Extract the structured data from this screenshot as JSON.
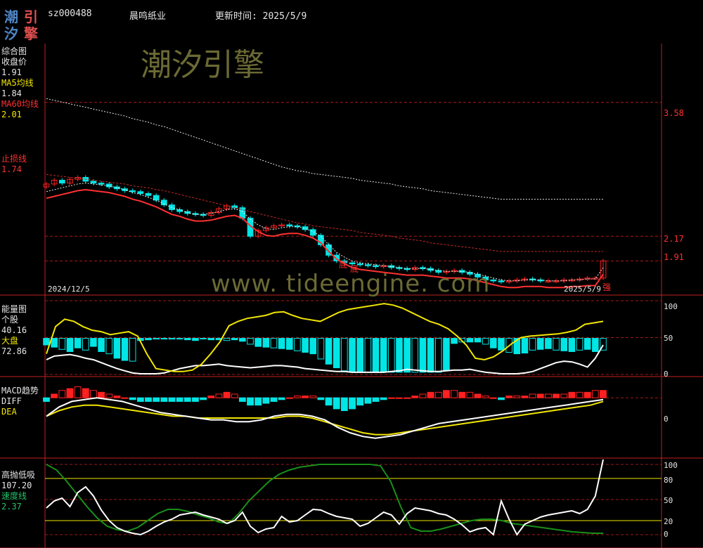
{
  "header": {
    "logo_chars": [
      "潮",
      "引",
      "汐",
      "擎"
    ],
    "stock_code": "sz000488",
    "stock_name": "晨鸣纸业",
    "update_label": "更新时间: 2025/5/9"
  },
  "watermarks": {
    "brand": "潮汐引擎",
    "url": "www. tideengine. com"
  },
  "colors": {
    "up": "#ff2020",
    "down": "#00e5e5",
    "ma5": "#ffffff",
    "ma60": "#ff3030",
    "dea": "#f2e600",
    "speed": "#1a8f1a"
  },
  "panels": {
    "main": {
      "title": "综合图",
      "close_label": "收盘价",
      "close_value": "1.91",
      "ma5_label": "MA5均线",
      "ma5_value": "1.84",
      "ma60_label": "MA60均线",
      "ma60_value": "2.01",
      "stop_label": "止损线",
      "stop_value": "1.74",
      "date_start": "2024/12/5",
      "date_end": "2025/5/9",
      "price_levels": [
        "3.58",
        "2.17",
        "1.91"
      ],
      "markers": [
        "底",
        "底"
      ],
      "strong_label": "强"
    },
    "energy": {
      "title": "能量图",
      "stock_label": "个股",
      "stock_value": "40.16",
      "market_label": "大盘",
      "market_value": "72.86",
      "axis": [
        "100",
        "50",
        "0"
      ]
    },
    "macd": {
      "title": "MACD趋势",
      "diff_label": "DIFF",
      "dea_label": "DEA",
      "axis": [
        "0"
      ]
    },
    "tide": {
      "title": "高抛低吸",
      "value": "107.20",
      "speed_label": "速度线",
      "speed_value": "2.37",
      "axis": [
        "100",
        "80",
        "50",
        "20",
        "0"
      ]
    }
  },
  "chart_data": [
    {
      "type": "candlestick",
      "title": "综合图",
      "x_start": "2024/12/5",
      "x_end": "2025/5/9",
      "ylim": [
        1.55,
        4.2
      ],
      "close": [
        2.72,
        2.76,
        2.73,
        2.77,
        2.79,
        2.75,
        2.73,
        2.72,
        2.69,
        2.67,
        2.65,
        2.64,
        2.62,
        2.6,
        2.55,
        2.5,
        2.45,
        2.43,
        2.41,
        2.4,
        2.39,
        2.42,
        2.46,
        2.49,
        2.47,
        2.36,
        2.17,
        2.23,
        2.26,
        2.28,
        2.29,
        2.28,
        2.27,
        2.24,
        2.18,
        2.08,
        1.97,
        1.91,
        1.89,
        1.88,
        1.87,
        1.86,
        1.85,
        1.86,
        1.84,
        1.83,
        1.82,
        1.84,
        1.83,
        1.81,
        1.79,
        1.8,
        1.81,
        1.79,
        1.77,
        1.74,
        1.71,
        1.7,
        1.69,
        1.7,
        1.71,
        1.72,
        1.71,
        1.7,
        1.7,
        1.7,
        1.71,
        1.71,
        1.72,
        1.73,
        1.73,
        1.91
      ],
      "ma5": [
        2.64,
        2.66,
        2.68,
        2.7,
        2.72,
        2.73,
        2.72,
        2.71,
        2.7,
        2.68,
        2.66,
        2.63,
        2.61,
        2.58,
        2.55,
        2.51,
        2.47,
        2.45,
        2.42,
        2.4,
        2.4,
        2.41,
        2.43,
        2.45,
        2.46,
        2.43,
        2.35,
        2.29,
        2.25,
        2.24,
        2.26,
        2.27,
        2.27,
        2.25,
        2.22,
        2.17,
        2.08,
        2.0,
        1.95,
        1.91,
        1.89,
        1.88,
        1.87,
        1.86,
        1.85,
        1.84,
        1.83,
        1.83,
        1.83,
        1.82,
        1.81,
        1.8,
        1.8,
        1.8,
        1.79,
        1.77,
        1.75,
        1.73,
        1.71,
        1.7,
        1.7,
        1.71,
        1.71,
        1.71,
        1.7,
        1.7,
        1.7,
        1.71,
        1.71,
        1.72,
        1.72,
        1.84
      ],
      "ma60": [
        2.82,
        2.81,
        2.8,
        2.79,
        2.78,
        2.77,
        2.76,
        2.75,
        2.74,
        2.73,
        2.72,
        2.7,
        2.69,
        2.68,
        2.66,
        2.65,
        2.63,
        2.61,
        2.59,
        2.57,
        2.55,
        2.53,
        2.51,
        2.49,
        2.47,
        2.45,
        2.43,
        2.41,
        2.39,
        2.37,
        2.35,
        2.33,
        2.31,
        2.3,
        2.28,
        2.27,
        2.26,
        2.25,
        2.24,
        2.23,
        2.21,
        2.2,
        2.19,
        2.18,
        2.17,
        2.15,
        2.14,
        2.13,
        2.12,
        2.1,
        2.09,
        2.08,
        2.07,
        2.06,
        2.05,
        2.04,
        2.03,
        2.02,
        2.01,
        2.01,
        2.01,
        2.01,
        2.01,
        2.01,
        2.01,
        2.01,
        2.01,
        2.01,
        2.01,
        2.01,
        2.01,
        2.01
      ],
      "price_levels": [
        3.58,
        2.17,
        1.91
      ]
    },
    {
      "type": "bar+line",
      "title": "能量图",
      "ylim": [
        0,
        100
      ],
      "series": [
        {
          "name": "个股",
          "values": [
            20,
            25,
            26,
            27,
            25,
            22,
            20,
            16,
            12,
            8,
            5,
            2,
            1,
            1,
            1,
            2,
            5,
            8,
            10,
            12,
            12,
            13,
            14,
            12,
            11,
            10,
            9,
            10,
            11,
            12,
            12,
            11,
            10,
            8,
            7,
            6,
            5,
            4,
            4,
            3,
            3,
            3,
            3,
            3,
            4,
            5,
            7,
            6,
            5,
            4,
            4,
            5,
            6,
            6,
            7,
            5,
            3,
            2,
            1,
            1,
            1,
            2,
            4,
            8,
            12,
            16,
            18,
            17,
            14,
            10,
            22,
            40
          ]
        },
        {
          "name": "大盘",
          "values": [
            28,
            65,
            75,
            72,
            65,
            60,
            58,
            54,
            56,
            58,
            52,
            28,
            8,
            6,
            4,
            4,
            6,
            14,
            28,
            44,
            66,
            72,
            76,
            78,
            80,
            84,
            85,
            80,
            76,
            74,
            72,
            78,
            84,
            88,
            90,
            92,
            94,
            96,
            94,
            90,
            84,
            78,
            72,
            68,
            62,
            52,
            40,
            22,
            20,
            24,
            32,
            42,
            50,
            52,
            53,
            54,
            55,
            57,
            60,
            68,
            70,
            72
          ]
        }
      ],
      "bars": [
        49,
        49,
        49,
        49,
        49,
        49,
        49,
        49,
        49,
        49,
        49,
        49,
        49,
        49,
        49,
        49,
        49,
        49,
        49,
        49,
        49,
        49,
        49,
        49,
        49,
        49,
        49,
        49,
        49,
        49,
        49,
        49,
        49,
        49,
        49,
        49,
        49,
        49,
        49,
        49,
        49,
        49,
        49,
        49,
        49,
        49,
        49,
        49,
        49,
        49,
        49,
        49,
        49,
        49,
        49,
        49,
        49,
        49,
        49,
        49,
        49,
        49,
        49,
        49,
        49,
        49,
        49,
        49,
        49,
        49,
        49,
        49
      ],
      "bar_bottoms": [
        40,
        37,
        34,
        31,
        36,
        33,
        38,
        31,
        28,
        22,
        19,
        18,
        46,
        47,
        48,
        48,
        48,
        48,
        47,
        46,
        48,
        47,
        47,
        46,
        47,
        45,
        41,
        38,
        37,
        36,
        35,
        34,
        32,
        30,
        28,
        21,
        14,
        9,
        5,
        3,
        4,
        3,
        3,
        3,
        3,
        3,
        3,
        3,
        3,
        3,
        3,
        6,
        42,
        44,
        44,
        44,
        41,
        36,
        33,
        30,
        28,
        29,
        33,
        34,
        35,
        33,
        32,
        31,
        33,
        34,
        31,
        33
      ],
      "axis_ticks": [
        100,
        50,
        0
      ]
    },
    {
      "type": "bar+line",
      "title": "MACD趋势",
      "ylim": [
        -0.32,
        0.1
      ],
      "macd_bars": [
        -0.02,
        0.02,
        0.04,
        0.05,
        0.06,
        0.05,
        0.04,
        0.03,
        0.02,
        0.01,
        0.0,
        -0.01,
        -0.02,
        -0.02,
        -0.02,
        -0.02,
        -0.02,
        -0.02,
        -0.02,
        -0.02,
        -0.01,
        0.01,
        0.02,
        0.03,
        0.02,
        -0.02,
        -0.04,
        -0.04,
        -0.03,
        -0.02,
        -0.01,
        0.0,
        0.01,
        0.01,
        0.01,
        -0.01,
        -0.04,
        -0.06,
        -0.07,
        -0.06,
        -0.04,
        -0.03,
        -0.02,
        -0.01,
        0.0,
        0.0,
        0.0,
        0.01,
        0.02,
        0.03,
        0.03,
        0.04,
        0.04,
        0.03,
        0.03,
        0.02,
        0.01,
        0.0,
        -0.01,
        0.01,
        0.01,
        0.01,
        0.02,
        0.02,
        0.02,
        0.02,
        0.02,
        0.03,
        0.03,
        0.03,
        0.04,
        0.04
      ],
      "series": [
        {
          "name": "DIFF",
          "values": [
            -0.1,
            -0.05,
            -0.02,
            -0.01,
            0.0,
            -0.01,
            -0.02,
            -0.04,
            -0.06,
            -0.08,
            -0.09,
            -0.1,
            -0.11,
            -0.12,
            -0.12,
            -0.13,
            -0.13,
            -0.12,
            -0.1,
            -0.09,
            -0.09,
            -0.1,
            -0.12,
            -0.16,
            -0.19,
            -0.21,
            -0.22,
            -0.21,
            -0.2,
            -0.18,
            -0.16,
            -0.14,
            -0.13,
            -0.12,
            -0.11,
            -0.1,
            -0.09,
            -0.08,
            -0.07,
            -0.06,
            -0.05,
            -0.04,
            -0.03,
            -0.02,
            -0.01
          ]
        },
        {
          "name": "DEA",
          "values": [
            -0.1,
            -0.07,
            -0.05,
            -0.04,
            -0.04,
            -0.05,
            -0.06,
            -0.07,
            -0.08,
            -0.09,
            -0.1,
            -0.1,
            -0.11,
            -0.11,
            -0.11,
            -0.11,
            -0.11,
            -0.11,
            -0.11,
            -0.1,
            -0.1,
            -0.11,
            -0.13,
            -0.15,
            -0.17,
            -0.19,
            -0.2,
            -0.2,
            -0.19,
            -0.18,
            -0.17,
            -0.16,
            -0.15,
            -0.14,
            -0.13,
            -0.12,
            -0.11,
            -0.1,
            -0.09,
            -0.08,
            -0.07,
            -0.06,
            -0.05,
            -0.04,
            -0.02
          ]
        }
      ],
      "axis_ticks": [
        0
      ]
    },
    {
      "type": "line",
      "title": "高抛低吸",
      "ylim": [
        0,
        110
      ],
      "series": [
        {
          "name": "高抛低吸",
          "values": [
            38,
            48,
            52,
            40,
            60,
            68,
            55,
            35,
            20,
            10,
            5,
            2,
            0,
            5,
            12,
            18,
            22,
            28,
            30,
            32,
            28,
            25,
            22,
            16,
            20,
            32,
            12,
            3,
            8,
            10,
            26,
            18,
            20,
            28,
            36,
            35,
            30,
            26,
            24,
            22,
            12,
            16,
            24,
            32,
            28,
            15,
            30,
            38,
            36,
            34,
            30,
            28,
            22,
            14,
            4,
            8,
            10,
            0,
            48,
            22,
            0,
            15,
            20,
            25,
            28,
            30,
            32,
            34,
            30,
            36,
            55,
            107
          ]
        },
        {
          "name": "速度线",
          "values": [
            100,
            92,
            76,
            58,
            40,
            24,
            12,
            7,
            5,
            10,
            20,
            30,
            36,
            36,
            33,
            28,
            24,
            18,
            16,
            30,
            48,
            62,
            76,
            86,
            92,
            96,
            98,
            100,
            100,
            100,
            100,
            100,
            100,
            98,
            76,
            40,
            10,
            5,
            5,
            8,
            12,
            16,
            20,
            22,
            22,
            20,
            16,
            14,
            12,
            10,
            8,
            6,
            4,
            3,
            2,
            2
          ]
        }
      ],
      "levels": [
        100,
        80,
        50,
        20,
        0
      ],
      "axis_ticks": [
        100,
        80,
        50,
        20,
        0
      ]
    }
  ]
}
